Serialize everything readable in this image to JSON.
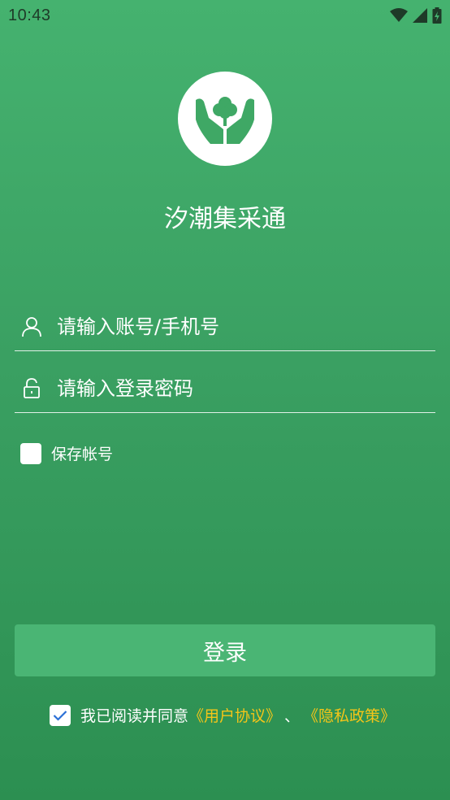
{
  "status_bar": {
    "time": "10:43"
  },
  "app": {
    "title": "汐潮集采通",
    "logo_icon": "hands-tree-icon"
  },
  "form": {
    "account_placeholder": "请输入账号/手机号",
    "password_placeholder": "请输入登录密码",
    "remember_label": "保存帐号",
    "remember_checked": false,
    "login_label": "登录"
  },
  "agreement": {
    "checked": true,
    "prefix": "我已阅读并同意",
    "user_agreement": "《用户协议》",
    "separator": "、",
    "privacy_policy": "《隐私政策》"
  },
  "colors": {
    "background_top": "#45b26f",
    "background_bottom": "#2c8f51",
    "logo_green": "#3fa865",
    "button": "#4ab574",
    "link": "#f5c518"
  }
}
